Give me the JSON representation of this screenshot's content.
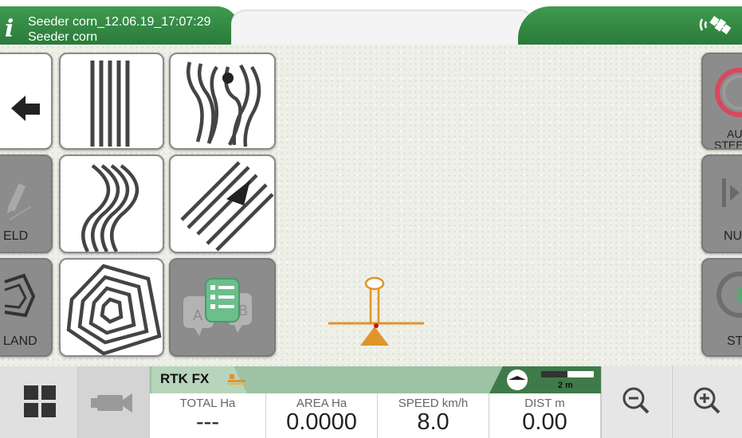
{
  "header": {
    "job_name": "Seeder corn_12.06.19_17:07:29",
    "implement_name": "Seeder corn",
    "info_icon": "i"
  },
  "left_panel": {
    "back_icon": "back-arrow-icon",
    "field_label": "ELD",
    "land_label": "LAND"
  },
  "guidance_patterns": [
    {
      "name": "straight-ab-pattern"
    },
    {
      "name": "free-curve-pattern"
    },
    {
      "name": "curve-pattern"
    },
    {
      "name": "heading-pattern"
    },
    {
      "name": "pivot-contour-pattern"
    },
    {
      "name": "ab-line-list-pattern"
    }
  ],
  "right_panel": {
    "autosteer_label_1": "AU",
    "autosteer_label_2": "STEE",
    "nudge_label": "NU",
    "start_label": "ST"
  },
  "status": {
    "gps_status": "RTK FX",
    "scale_label": "2 m"
  },
  "metrics": [
    {
      "label": "TOTAL Ha",
      "value": "---"
    },
    {
      "label": "AREA Ha",
      "value": "0.0000"
    },
    {
      "label": "SPEED km/h",
      "value": "8.0"
    },
    {
      "label": "DIST m",
      "value": "0.00"
    }
  ],
  "colors": {
    "brand_green": "#2e8540",
    "tractor_orange": "#e0942a",
    "autosteer_red": "#d9475e"
  }
}
